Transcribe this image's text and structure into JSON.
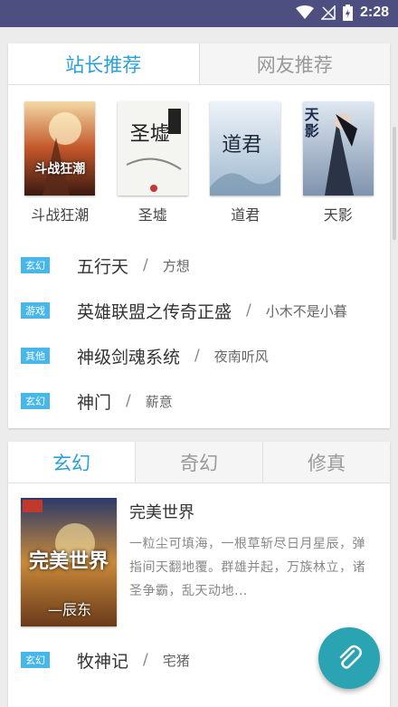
{
  "status_bar": {
    "time": "2:28"
  },
  "colors": {
    "status_bar": "#4c4f7f",
    "accent": "#2a9fd8",
    "tag": "#46b7e8",
    "fab": "#2aa3b2"
  },
  "recommend": {
    "tabs": [
      "站长推荐",
      "网友推荐"
    ],
    "covers": [
      {
        "title": "斗战狂潮",
        "cover_text": "斗战狂潮"
      },
      {
        "title": "圣墟",
        "cover_text": "圣墟"
      },
      {
        "title": "道君",
        "cover_text": "道君"
      },
      {
        "title": "天影",
        "cover_text": "天影"
      }
    ],
    "books": [
      {
        "tag": "玄幻",
        "title": "五行天",
        "sep": "/",
        "author": "方想"
      },
      {
        "tag": "游戏",
        "title": "英雄联盟之传奇正盛",
        "sep": "/",
        "author": "小木不是小暮"
      },
      {
        "tag": "其他",
        "title": "神级剑魂系统",
        "sep": "/",
        "author": "夜南听风"
      },
      {
        "tag": "玄幻",
        "title": "神门",
        "sep": "/",
        "author": "薪意"
      }
    ]
  },
  "category": {
    "tabs": [
      "玄幻",
      "奇幻",
      "修真"
    ],
    "feature": {
      "title": "完美世界",
      "cover_text": "完美世界",
      "cover_author": "—辰东",
      "description": "一粒尘可填海，一根草斩尽日月星辰，弹指间天翻地覆。群雄并起，万族林立，诸圣争霸，乱天动地..."
    },
    "books": [
      {
        "tag": "玄幻",
        "title": "牧神记",
        "sep": "/",
        "author": "宅猪"
      }
    ]
  },
  "fab": {
    "icon": "paperclip-icon"
  }
}
